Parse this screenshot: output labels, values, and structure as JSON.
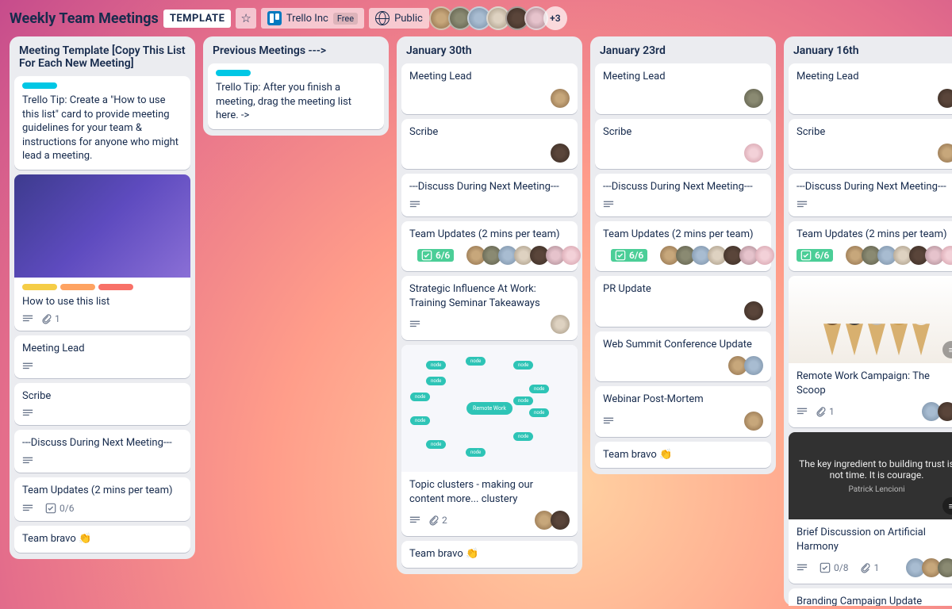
{
  "header": {
    "title": "Weekly Team Meetings",
    "template_chip": "TEMPLATE",
    "workspace": "Trello Inc",
    "plan_badge": "Free",
    "visibility": "Public",
    "more_members": "+3"
  },
  "lists": [
    {
      "title": "Meeting Template [Copy This List For Each New Meeting]",
      "cards": [
        {
          "labels": [
            "cyan"
          ],
          "title": "Trello Tip: Create a \"How to use this list\" card to provide meeting guidelines for your team & instructions for anyone who might lead a meeting."
        },
        {
          "cover": "purple",
          "labels": [
            "yellow",
            "orange",
            "red"
          ],
          "title": "How to use this list",
          "desc": true,
          "attachments": "1"
        },
        {
          "title": "Meeting Lead",
          "desc": true
        },
        {
          "title": "Scribe",
          "desc": true
        },
        {
          "title": "---Discuss During Next Meeting---",
          "desc": true
        },
        {
          "title": "Team Updates (2 mins per team)",
          "desc": true,
          "checklist": "0/6"
        },
        {
          "title": "Team bravo 👏"
        }
      ]
    },
    {
      "title": "Previous Meetings --->",
      "cards": [
        {
          "labels": [
            "cyan"
          ],
          "title": "Trello Tip: After you finish a meeting, drag the meeting list here. ->"
        }
      ]
    },
    {
      "title": "January 30th",
      "cards": [
        {
          "title": "Meeting Lead",
          "members": [
            "av1"
          ]
        },
        {
          "title": "Scribe",
          "members": [
            "av5"
          ]
        },
        {
          "title": "---Discuss During Next Meeting---",
          "desc": true
        },
        {
          "title": "Team Updates (2 mins per team)",
          "desc": true,
          "checklist_done": "6/6",
          "members": [
            "av1",
            "av7",
            "av3",
            "av4",
            "av5",
            "av2",
            "av6"
          ]
        },
        {
          "title": "Strategic Influence At Work: Training Seminar Takeaways",
          "desc": true,
          "members": [
            "av4"
          ]
        },
        {
          "cover": "mindmap",
          "title": "Topic clusters - making our content more... clustery",
          "desc": true,
          "attachments": "2",
          "members": [
            "av1",
            "av5"
          ]
        },
        {
          "title": "Team bravo 👏"
        }
      ]
    },
    {
      "title": "January 23rd",
      "cards": [
        {
          "title": "Meeting Lead",
          "members": [
            "av7"
          ]
        },
        {
          "title": "Scribe",
          "members": [
            "av6"
          ]
        },
        {
          "title": "---Discuss During Next Meeting---",
          "desc": true
        },
        {
          "title": "Team Updates (2 mins per team)",
          "desc": true,
          "checklist_done": "6/6",
          "members": [
            "av1",
            "av7",
            "av3",
            "av4",
            "av5",
            "av2",
            "av6"
          ]
        },
        {
          "title": "PR Update",
          "members": [
            "av5"
          ]
        },
        {
          "title": "Web Summit Conference Update",
          "members": [
            "av1",
            "av3"
          ]
        },
        {
          "title": "Webinar Post-Mortem",
          "desc": true,
          "members": [
            "av1"
          ]
        },
        {
          "title": "Team bravo 👏"
        }
      ]
    },
    {
      "title": "January 16th",
      "cards": [
        {
          "title": "Meeting Lead",
          "members": [
            "av5"
          ]
        },
        {
          "title": "Scribe",
          "members": [
            "av1"
          ]
        },
        {
          "title": "---Discuss During Next Meeting---",
          "desc": true
        },
        {
          "title": "Team Updates (2 mins per team)",
          "checklist_done": "6/6",
          "members": [
            "av1",
            "av7",
            "av3",
            "av4",
            "av5",
            "av2",
            "av6"
          ]
        },
        {
          "cover": "icecream",
          "title": "Remote Work Campaign: The Scoop",
          "desc": true,
          "attachments": "1",
          "members": [
            "av3",
            "av5"
          ]
        },
        {
          "cover": "quote",
          "quote_text": "The key ingredient to building trust is not time. It is courage.",
          "quote_author": "Patrick Lencioni",
          "title": "Brief Discussion on Artificial Harmony",
          "desc": true,
          "attachments": "1",
          "checklist": "0/8",
          "members": [
            "av3",
            "av1",
            "av7"
          ]
        },
        {
          "title": "Branding Campaign Update"
        }
      ]
    }
  ]
}
